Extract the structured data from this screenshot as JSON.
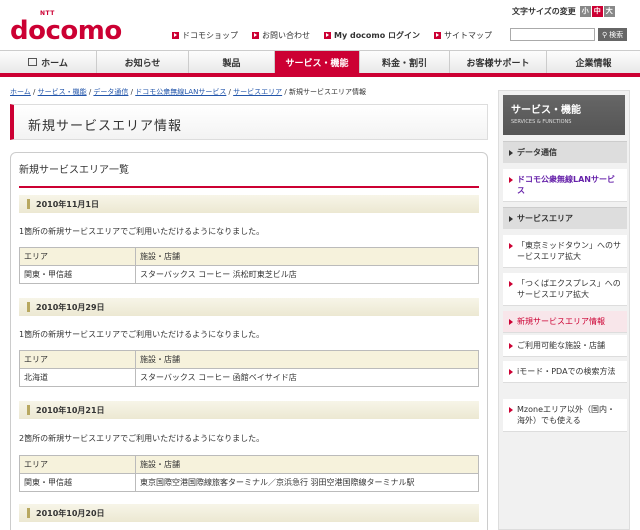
{
  "header": {
    "ntt": "NTT",
    "brand": "docomo",
    "font_size_label": "文字サイズの変更",
    "font_sizes": [
      "小",
      "中",
      "大"
    ],
    "links": [
      "ドコモショップ",
      "お問い合わせ",
      "My docomo ログイン",
      "サイトマップ"
    ],
    "search_placeholder": "",
    "search_button": "検索"
  },
  "nav": {
    "items": [
      "ホーム",
      "お知らせ",
      "製品",
      "サービス・機能",
      "料金・割引",
      "お客様サポート",
      "企業情報"
    ],
    "active": "サービス・機能"
  },
  "breadcrumb": {
    "links": [
      "ホーム",
      "サービス・機能",
      "データ通信",
      "ドコモ公衆無線LANサービス",
      "サービスエリア"
    ],
    "current": "新規サービスエリア情報"
  },
  "page_title": "新規サービスエリア情報",
  "content": {
    "section_title": "新規サービスエリア一覧",
    "col_area": "エリア",
    "col_facility": "施設・店舗",
    "entries": [
      {
        "date": "2010年11月1日",
        "message": "1箇所の新規サービスエリアでご利用いただけるようになりました。",
        "area": "関東・甲信越",
        "facility": "スターバックス コーヒー 浜松町東芝ビル店"
      },
      {
        "date": "2010年10月29日",
        "message": "1箇所の新規サービスエリアでご利用いただけるようになりました。",
        "area": "北海道",
        "facility": "スターバックス コーヒー 函館ベイサイド店"
      },
      {
        "date": "2010年10月21日",
        "message": "2箇所の新規サービスエリアでご利用いただけるようになりました。",
        "area": "関東・甲信越",
        "facility": "東京国際空港国際線旅客ターミナル／京浜急行 羽田空港国際線ターミナル駅"
      },
      {
        "date": "2010年10月20日"
      }
    ]
  },
  "sidebar": {
    "title": "サービス・機能",
    "subtitle": "SERVICES & FUNCTIONS",
    "cat1": "データ通信",
    "cat1_link": "ドコモ公衆無線LANサービス",
    "cat2": "サービスエリア",
    "links": [
      "「東京ミッドタウン」へのサービスエリア拡大",
      "「つくばエクスプレス」へのサービスエリア拡大",
      "新規サービスエリア情報",
      "ご利用可能な施設・店舗",
      "iモード・PDAでの検索方法",
      "Mzoneエリア以外（国内・海外）でも使える"
    ]
  },
  "colors": {
    "brand": "#cc0033",
    "link": "#2255aa",
    "purple": "#6622aa"
  }
}
